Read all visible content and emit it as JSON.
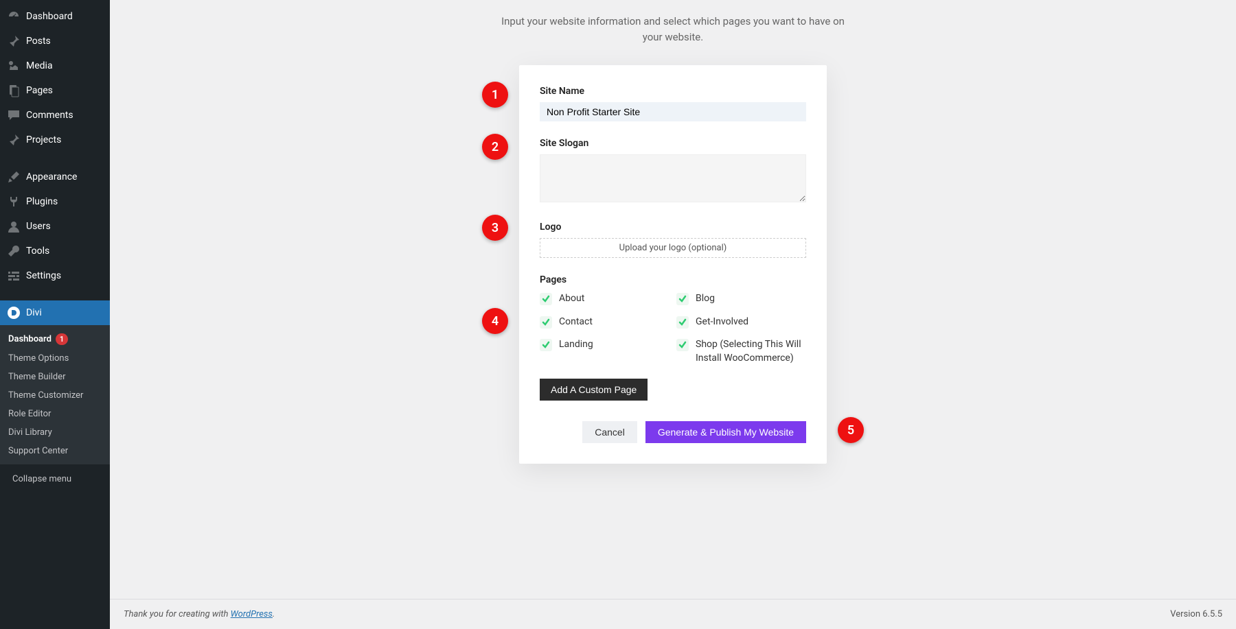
{
  "sidebar": {
    "items": [
      {
        "icon": "dashboard",
        "label": "Dashboard"
      },
      {
        "icon": "pin",
        "label": "Posts"
      },
      {
        "icon": "media",
        "label": "Media"
      },
      {
        "icon": "pages",
        "label": "Pages"
      },
      {
        "icon": "comment",
        "label": "Comments"
      },
      {
        "icon": "pin",
        "label": "Projects"
      }
    ],
    "items2": [
      {
        "icon": "brush",
        "label": "Appearance"
      },
      {
        "icon": "plugin",
        "label": "Plugins"
      },
      {
        "icon": "user",
        "label": "Users"
      },
      {
        "icon": "tool",
        "label": "Tools"
      },
      {
        "icon": "settings",
        "label": "Settings"
      }
    ],
    "active": {
      "icon": "divi",
      "label": "Divi"
    },
    "sub": [
      {
        "label": "Dashboard",
        "bold": true,
        "badge": "1"
      },
      {
        "label": "Theme Options"
      },
      {
        "label": "Theme Builder"
      },
      {
        "label": "Theme Customizer"
      },
      {
        "label": "Role Editor"
      },
      {
        "label": "Divi Library"
      },
      {
        "label": "Support Center"
      }
    ],
    "collapse": "Collapse menu"
  },
  "intro": "Input your website information and select which pages you want to have on your website.",
  "form": {
    "siteNameLabel": "Site Name",
    "siteNameValue": "Non Profit Starter Site",
    "sloganLabel": "Site Slogan",
    "sloganValue": "",
    "logoLabel": "Logo",
    "logoUploadText": "Upload your logo (optional)",
    "pagesLabel": "Pages",
    "pages": [
      {
        "label": "About",
        "checked": true
      },
      {
        "label": "Blog",
        "checked": true
      },
      {
        "label": "Contact",
        "checked": true
      },
      {
        "label": "Get-Involved",
        "checked": true
      },
      {
        "label": "Landing",
        "checked": true
      },
      {
        "label": "Shop (Selecting This Will Install WooCommerce)",
        "checked": true
      }
    ],
    "addCustomPage": "Add A Custom Page",
    "cancel": "Cancel",
    "generate": "Generate & Publish My Website"
  },
  "annotations": [
    "1",
    "2",
    "3",
    "4",
    "5"
  ],
  "footer": {
    "thanks_prefix": "Thank you for creating with ",
    "thanks_link": "WordPress",
    "thanks_suffix": ".",
    "version": "Version 6.5.5"
  }
}
